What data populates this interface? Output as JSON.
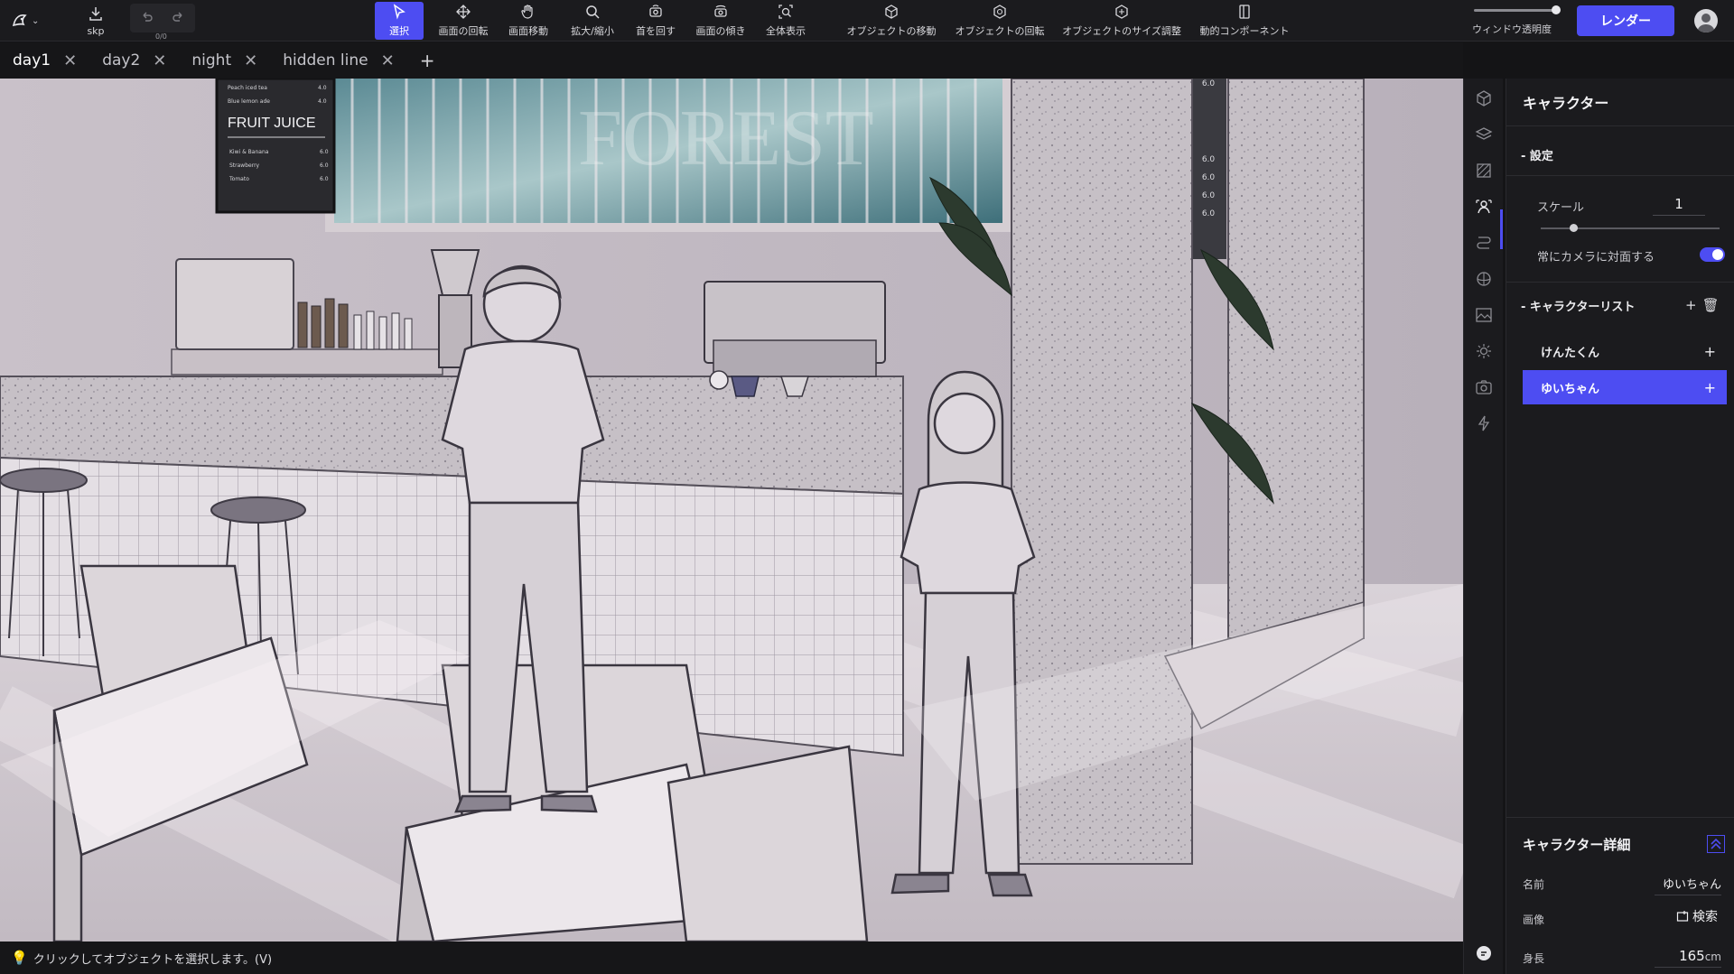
{
  "toolbar": {
    "skp_label": "skp",
    "undo_count": "0/0",
    "tools": [
      {
        "label": "選択",
        "icon": "cursor-icon",
        "active": true
      },
      {
        "label": "画面の回転",
        "icon": "rotate-view-icon"
      },
      {
        "label": "画面移動",
        "icon": "hand-icon"
      },
      {
        "label": "拡大/縮小",
        "icon": "zoom-icon"
      },
      {
        "label": "首を回す",
        "icon": "head-turn-icon"
      },
      {
        "label": "画面の傾き",
        "icon": "tilt-icon"
      },
      {
        "label": "全体表示",
        "icon": "fit-all-icon"
      },
      {
        "label": "オブジェクトの移動",
        "icon": "move-object-icon"
      },
      {
        "label": "オブジェクトの回転",
        "icon": "rotate-object-icon"
      },
      {
        "label": "オブジェクトのサイズ調整",
        "icon": "resize-object-icon"
      },
      {
        "label": "動的コンポーネント",
        "icon": "dynamic-component-icon"
      }
    ],
    "window_opacity_label": "ウィンドウ透明度",
    "window_opacity": 1.0,
    "render_label": "レンダー"
  },
  "tabs": [
    {
      "label": "day1",
      "active": true
    },
    {
      "label": "day2"
    },
    {
      "label": "night"
    },
    {
      "label": "hidden line"
    }
  ],
  "tab_add": "+",
  "viewport": {
    "menu_title": "FRUIT JUICE",
    "menu_items": [
      "Peach iced tea",
      "Blue lemon ade",
      "Kiwi & Banana",
      "Strawberry",
      "Tomato"
    ],
    "menu_prices": [
      "4.0",
      "4.0",
      "6.0",
      "6.0",
      "6.0"
    ],
    "wall_menu_prices": [
      "6.0",
      "6.0",
      "6.0",
      "6.0",
      "6.0"
    ],
    "poster_text": "FOREST"
  },
  "status": {
    "hint": "クリックしてオブジェクトを選択します。(V)"
  },
  "panel": {
    "title": "キャラクター",
    "settings_section": "設定",
    "scale_label": "スケール",
    "scale_value": "1",
    "face_camera_label": "常にカメラに対面する",
    "face_camera": true,
    "list_section": "キャラクターリスト",
    "characters": [
      {
        "name": "けんたくん",
        "selected": false
      },
      {
        "name": "ゆいちゃん",
        "selected": true
      }
    ],
    "detail_title": "キャラクター詳細",
    "name_label": "名前",
    "name_value": "ゆいちゃん",
    "image_label": "画像",
    "search_label": "検索",
    "height_label": "身長",
    "height_value": "165",
    "height_unit": "cm"
  }
}
